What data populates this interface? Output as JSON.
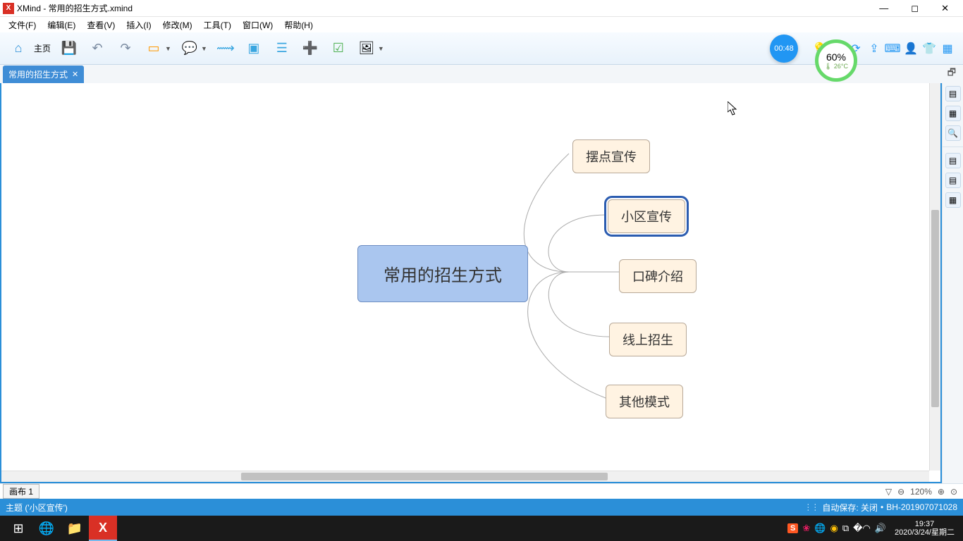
{
  "title": "XMind - 常用的招生方式.xmind",
  "app_short": "X",
  "menu": [
    "文件(F)",
    "编辑(E)",
    "查看(V)",
    "插入(I)",
    "修改(M)",
    "工具(T)",
    "窗口(W)",
    "帮助(H)"
  ],
  "toolbar": {
    "home_label": "主页",
    "timer": "00:48"
  },
  "gauge": {
    "percent": "60%",
    "sub": "🌡 26°C"
  },
  "tab": {
    "label": "常用的招生方式"
  },
  "mindmap": {
    "root": "常用的招生方式",
    "children": [
      "摆点宣传",
      "小区宣传",
      "口碑介绍",
      "线上招生",
      "其他模式"
    ],
    "selected_index": 1
  },
  "sheet": {
    "label": "画布 1"
  },
  "zoom": {
    "level": "120%"
  },
  "status": {
    "left": "主题 ('小区宣传')",
    "autosave": "自动保存: 关闭",
    "machine": "BH-201907071028"
  },
  "taskbar": {
    "clock_time": "19:37",
    "clock_date": "2020/3/24/星期二"
  }
}
